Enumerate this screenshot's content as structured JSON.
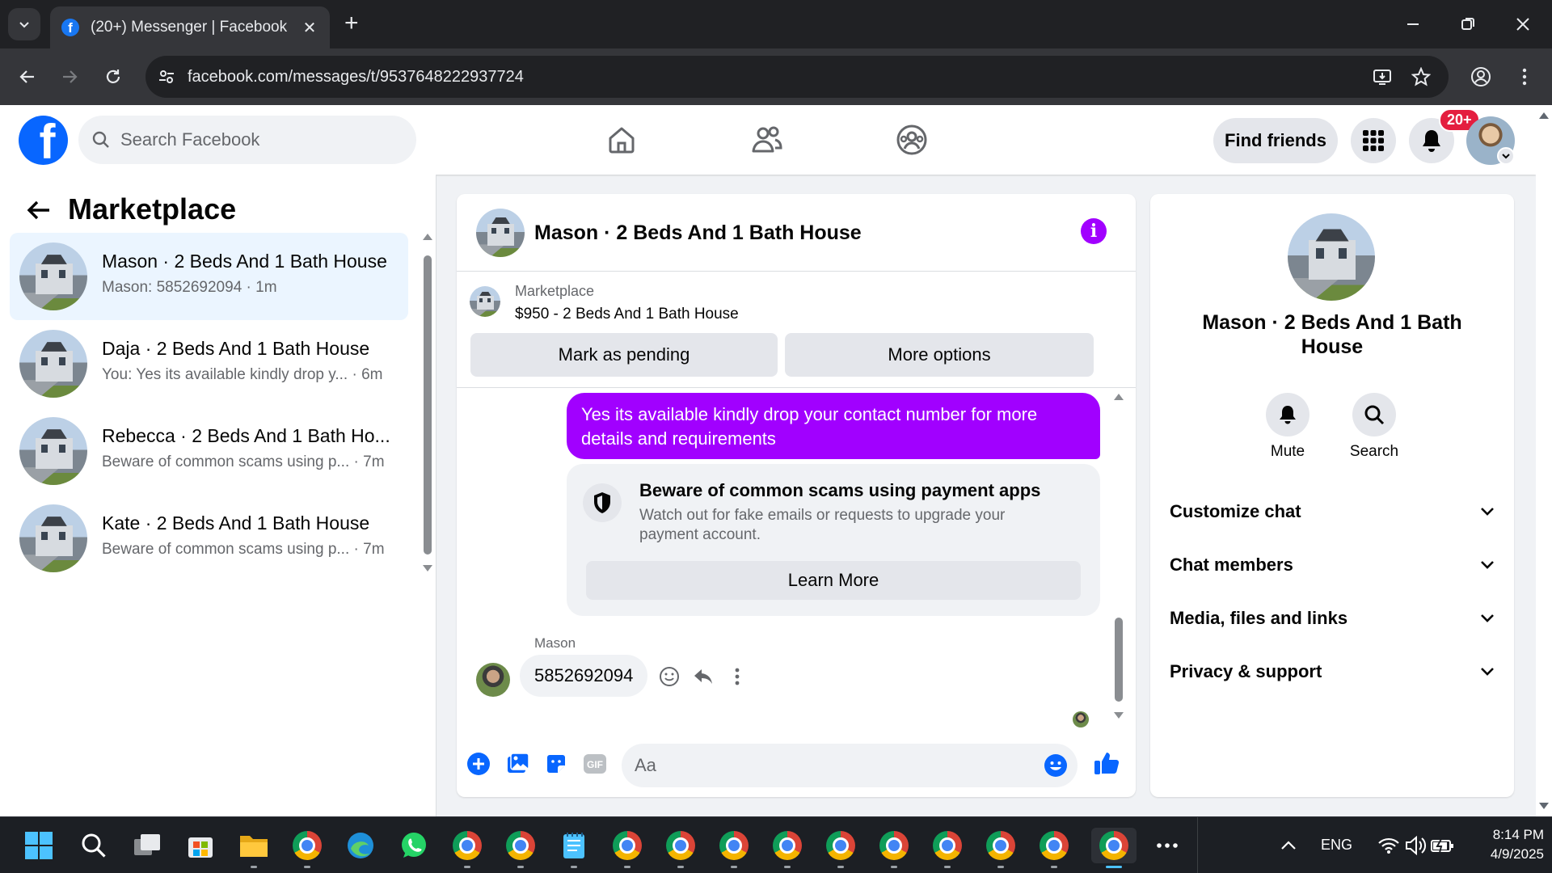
{
  "browser": {
    "tab_title": "(20+) Messenger | Facebook",
    "url": "facebook.com/messages/t/9537648222937724"
  },
  "header": {
    "search_placeholder": "Search Facebook",
    "find_friends": "Find friends",
    "notification_count": "20+"
  },
  "sidebar": {
    "title": "Marketplace",
    "conversations": [
      {
        "name": "Mason · 2 Beds And 1 Bath House",
        "preview": "Mason: 5852692094 · 1m",
        "active": true
      },
      {
        "name": "Daja · 2 Beds And 1 Bath House",
        "preview": "You: Yes its available kindly drop y... · 6m",
        "active": false
      },
      {
        "name": "Rebecca · 2 Beds And 1 Bath Ho...",
        "preview": "Beware of common scams using p... · 7m",
        "active": false
      },
      {
        "name": "Kate · 2 Beds And 1 Bath House",
        "preview": "Beware of common scams using p... · 7m",
        "active": false
      }
    ]
  },
  "chat": {
    "title": "Mason · 2 Beds And 1 Bath House",
    "listing": {
      "label": "Marketplace",
      "price_title": "$950 - 2 Beds And 1 Bath House",
      "mark_pending": "Mark as pending",
      "more_options": "More options"
    },
    "outgoing_message": "Yes its available kindly drop your contact number for more details and requirements",
    "scam_notice": {
      "title": "Beware of common scams using payment apps",
      "description": "Watch out for fake emails or requests to upgrade your payment account.",
      "button": "Learn More"
    },
    "incoming": {
      "sender": "Mason",
      "message": "5852692094"
    },
    "composer_placeholder": "Aa"
  },
  "details": {
    "name": "Mason · 2 Beds And 1 Bath House",
    "actions": [
      "Mute",
      "Search"
    ],
    "sections": [
      "Customize chat",
      "Chat members",
      "Media, files and links",
      "Privacy & support"
    ]
  },
  "taskbar": {
    "language": "ENG",
    "time": "8:14 PM",
    "date": "4/9/2025"
  },
  "colors": {
    "facebook_blue": "#0866ff",
    "messenger_purple": "#a100ff",
    "active_convo_bg": "#ebf5ff",
    "badge_red": "#e41e3f"
  }
}
